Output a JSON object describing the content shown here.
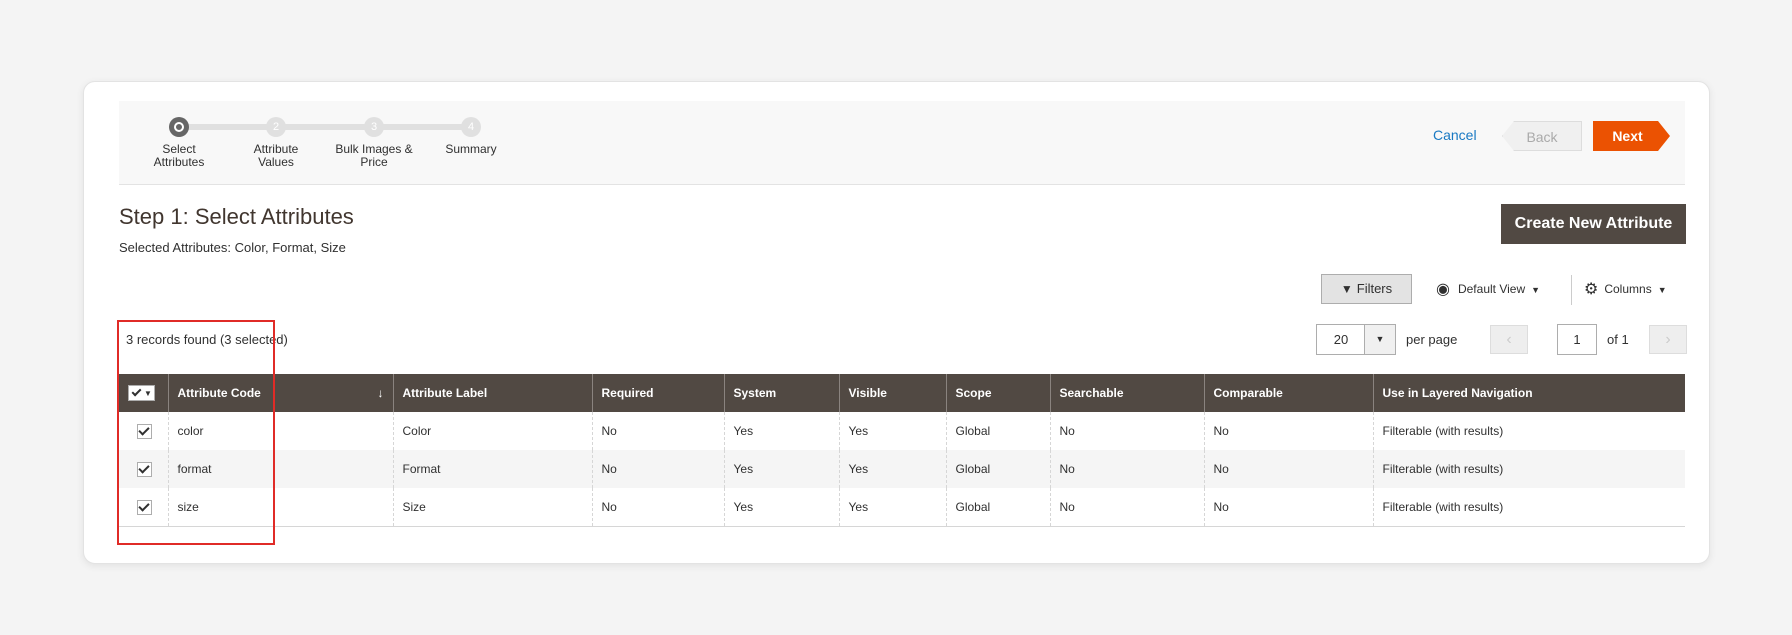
{
  "wizard": {
    "steps": [
      {
        "label": "Select Attributes",
        "number": ""
      },
      {
        "label": "Attribute Values",
        "number": "2"
      },
      {
        "label": "Bulk Images & Price",
        "number": "3"
      },
      {
        "label": "Summary",
        "number": "4"
      }
    ],
    "cancel_label": "Cancel",
    "back_label": "Back",
    "next_label": "Next"
  },
  "header": {
    "title": "Step 1: Select Attributes",
    "selected_attributes": "Selected Attributes: Color, Format, Size",
    "create_button": "Create New Attribute"
  },
  "toolbar": {
    "filters_label": "Filters",
    "view_label": "Default View",
    "columns_label": "Columns",
    "records_text": "3 records found (3 selected)",
    "per_page_value": "20",
    "per_page_label": "per page",
    "page_value": "1",
    "page_of": "of 1"
  },
  "table": {
    "columns": [
      "Attribute Code",
      "Attribute Label",
      "Required",
      "System",
      "Visible",
      "Scope",
      "Searchable",
      "Comparable",
      "Use in Layered Navigation"
    ],
    "rows": [
      {
        "checked": true,
        "cells": [
          "color",
          "Color",
          "No",
          "Yes",
          "Yes",
          "Global",
          "No",
          "No",
          "Filterable (with results)"
        ]
      },
      {
        "checked": true,
        "cells": [
          "format",
          "Format",
          "No",
          "Yes",
          "Yes",
          "Global",
          "No",
          "No",
          "Filterable (with results)"
        ]
      },
      {
        "checked": true,
        "cells": [
          "size",
          "Size",
          "No",
          "Yes",
          "Yes",
          "Global",
          "No",
          "No",
          "Filterable (with results)"
        ]
      }
    ]
  },
  "colors": {
    "accent": "#eb5202",
    "header_bg": "#514943",
    "link": "#1979c3",
    "highlight": "#e02b27"
  },
  "icons": {
    "filter": "funnel-icon",
    "view": "eye-icon",
    "columns": "gear-icon"
  }
}
